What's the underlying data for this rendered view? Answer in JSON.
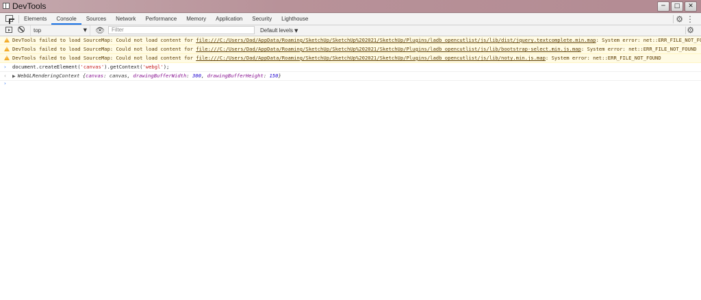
{
  "window": {
    "title": "DevTools",
    "buttons": {
      "minimize": "─",
      "maximize": "□",
      "close": "✕"
    }
  },
  "tabs": [
    {
      "label": "Elements"
    },
    {
      "label": "Console",
      "active": true
    },
    {
      "label": "Sources"
    },
    {
      "label": "Network"
    },
    {
      "label": "Performance"
    },
    {
      "label": "Memory"
    },
    {
      "label": "Application"
    },
    {
      "label": "Security"
    },
    {
      "label": "Lighthouse"
    }
  ],
  "toolbar": {
    "context": "top",
    "filter_placeholder": "Filter",
    "levels": "Default levels"
  },
  "console": {
    "warnings": [
      {
        "prefix": "DevTools failed to load SourceMap: Could not load content for ",
        "link": "file:///C:/Users/Dad/AppData/Roaming/SketchUp/SketchUp%202021/SketchUp/Plugins/ladb_opencutlist/js/lib/dist/jquery.textcomplete.min.map",
        "suffix": ": System error: net::ERR_FILE_NOT_FOUND"
      },
      {
        "prefix": "DevTools failed to load SourceMap: Could not load content for ",
        "link": "file:///C:/Users/Dad/AppData/Roaming/SketchUp/SketchUp%202021/SketchUp/Plugins/ladb_opencutlist/js/lib/bootstrap-select.min.js.map",
        "suffix": ": System error: net::ERR_FILE_NOT_FOUND"
      },
      {
        "prefix": "DevTools failed to load SourceMap: Could not load content for ",
        "link": "file:///C:/Users/Dad/AppData/Roaming/SketchUp/SketchUp%202021/SketchUp/Plugins/ladb_opencutlist/js/lib/noty.min.js.map",
        "suffix": ": System error: net::ERR_FILE_NOT_FOUND"
      }
    ],
    "input": {
      "before": "document.createElement(",
      "arg1": "'canvas'",
      "middle": ").getContext(",
      "arg2": "'webgl'",
      "after": ");"
    },
    "output": {
      "type": "WebGLRenderingContext",
      "open": " {",
      "p1_name": "canvas",
      "p1_value": "canvas",
      "p2_name": "drawingBufferWidth",
      "p2_value": "300",
      "p3_name": "drawingBufferHeight",
      "p3_value": "150",
      "close": "}"
    }
  }
}
